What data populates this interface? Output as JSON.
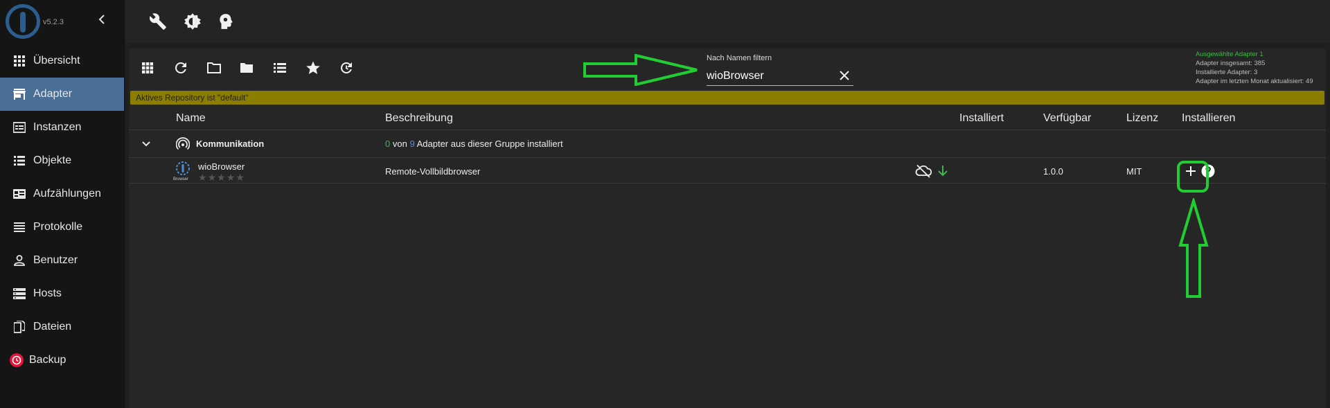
{
  "app": {
    "version": "v5.2.3"
  },
  "sidebar": {
    "items": [
      {
        "label": "Übersicht",
        "icon": "grid-icon",
        "active": false
      },
      {
        "label": "Adapter",
        "icon": "store-icon",
        "active": true
      },
      {
        "label": "Instanzen",
        "icon": "instances-icon",
        "active": false
      },
      {
        "label": "Objekte",
        "icon": "list-icon",
        "active": false
      },
      {
        "label": "Aufzählungen",
        "icon": "enum-icon",
        "active": false
      },
      {
        "label": "Protokolle",
        "icon": "log-icon",
        "active": false
      },
      {
        "label": "Benutzer",
        "icon": "user-icon",
        "active": false
      },
      {
        "label": "Hosts",
        "icon": "hosts-icon",
        "active": false
      },
      {
        "label": "Dateien",
        "icon": "files-icon",
        "active": false
      },
      {
        "label": "Backup",
        "icon": "backup-icon",
        "active": false
      }
    ]
  },
  "topbar": {
    "icons": [
      "wrench-icon",
      "settings-brightness-icon",
      "expert-head-icon"
    ]
  },
  "toolbar": {
    "icons": [
      "tile-view-icon",
      "refresh-icon",
      "folder-open-icon",
      "folder-closed-icon",
      "list-icon",
      "star-icon",
      "update-icon"
    ]
  },
  "filter": {
    "label": "Nach Namen filtern",
    "value": "wioBrowser"
  },
  "stats": {
    "selected": "Ausgewählte Adapter 1",
    "total": "Adapter insgesamt: 385",
    "installed": "Installierte Adapter: 3",
    "updated": "Adapter im letzten Monat aktualisiert: 49"
  },
  "repo_notice": "Aktives Repository ist \"default\"",
  "table": {
    "headers": {
      "name": "Name",
      "description": "Beschreibung",
      "installed": "Installiert",
      "available": "Verfügbar",
      "license": "Lizenz",
      "install": "Installieren"
    },
    "group": {
      "name": "Kommunikation",
      "installed_count": "0",
      "von": "von",
      "total_count": "9",
      "suffix": "Adapter aus dieser Gruppe installiert"
    },
    "adapter": {
      "name": "wioBrowser",
      "icon_caption": "Browser",
      "description": "Remote-Vollbildbrowser",
      "available": "1.0.0",
      "license": "MIT",
      "rating": "0 of 5 stars"
    }
  },
  "colors": {
    "accent": "#4a6f97",
    "repo_bar": "#8b7d00",
    "annotation": "#22cc33"
  }
}
